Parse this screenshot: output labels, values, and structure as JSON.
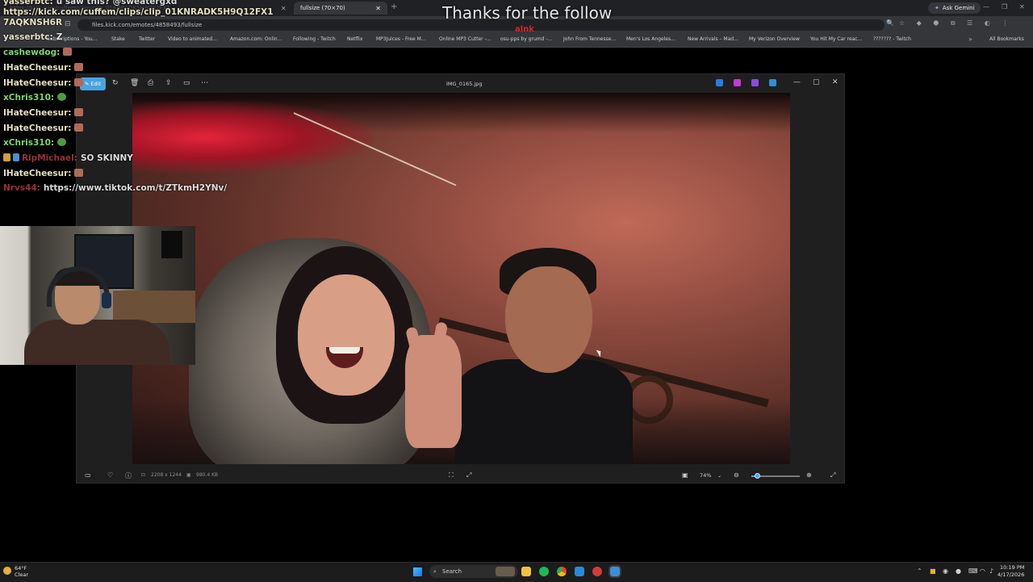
{
  "browser": {
    "tabs": [
      {
        "label": "https://kick.com/cuffem/clips/clip_01KNRADK5H9Q12FX1",
        "active": false
      },
      {
        "label": "fullsize (70×70)",
        "active": true
      }
    ],
    "ask_gemini": "Ask Gemini",
    "url": "files.kick.com/emotes/4858493/fullsize",
    "bookmarks": [
      "Subscriptions - You...",
      "Stake",
      "Twitter",
      "Video to animated...",
      "Amazon.com: Onlin...",
      "Following - Twitch",
      "Netflix",
      "MP3Juices - Free M...",
      "Online MP3 Cutter -...",
      "osu-pps by grumd -...",
      "John From Tennesse...",
      "Men's Los Angeles...",
      "New Arrivals – Mad...",
      "My Verizon Overview",
      "You Hit My Car reac...",
      "??????? - Twitch"
    ],
    "all_bookmarks": "All Bookmarks"
  },
  "alert": {
    "text": "Thanks for the follow",
    "sub": "alnk"
  },
  "chat": [
    {
      "user": "yasserbtc:",
      "msg": "u saw this? @sweatergxd",
      "color": "u-cream",
      "emote": ""
    },
    {
      "user": "",
      "msg": "https://kick.com/cuffem/clips/clip_01KNRADK5H9Q12FX1",
      "color": "u-cream",
      "emote": ""
    },
    {
      "user": "",
      "msg": "7AQKNSH6R",
      "color": "u-cream",
      "emote": ""
    },
    {
      "user": "yasserbtc:",
      "msg": "Z",
      "color": "u-cream",
      "emote": ""
    },
    {
      "user": "cashewdog:",
      "msg": "",
      "color": "u-green",
      "emote": "brick"
    },
    {
      "user": "IHateCheesur:",
      "msg": "",
      "color": "u-cream",
      "emote": "brick"
    },
    {
      "user": "IHateCheesur:",
      "msg": "",
      "color": "u-cream",
      "emote": "brick"
    },
    {
      "user": "xChris310:",
      "msg": "",
      "color": "u-green",
      "emote": "frog"
    },
    {
      "user": "IHateCheesur:",
      "msg": "",
      "color": "u-cream",
      "emote": "brick"
    },
    {
      "user": "IHateCheesur:",
      "msg": "",
      "color": "u-cream",
      "emote": "brick"
    },
    {
      "user": "xChris310:",
      "msg": "",
      "color": "u-green",
      "emote": "frog"
    },
    {
      "user": "RipMichael:",
      "msg": "SO SKINNY",
      "color": "u-red",
      "emote": "badges"
    },
    {
      "user": "IHateCheesur:",
      "msg": "",
      "color": "u-cream",
      "emote": "brick"
    },
    {
      "user": "Nrvs44:",
      "msg": "https://www.tiktok.com/t/ZTkmH2YNv/",
      "color": "u-red",
      "emote": ""
    }
  ],
  "photos": {
    "edit_label": "Edit",
    "title": "IMG_0165.jpg",
    "dimensions": "2208 x 1244",
    "file_size": "980.4 KB",
    "zoom_label": "74%",
    "zoom_level": 0.12
  },
  "taskbar": {
    "weather_temp": "64°F",
    "weather_cond": "Clear",
    "search_placeholder": "Search",
    "time": "10:19 PM",
    "date": "4/17/2026"
  },
  "colors": {
    "accent": "#4aa3df",
    "chat_green": "#7bd66b",
    "alert_red": "#d4262a"
  }
}
